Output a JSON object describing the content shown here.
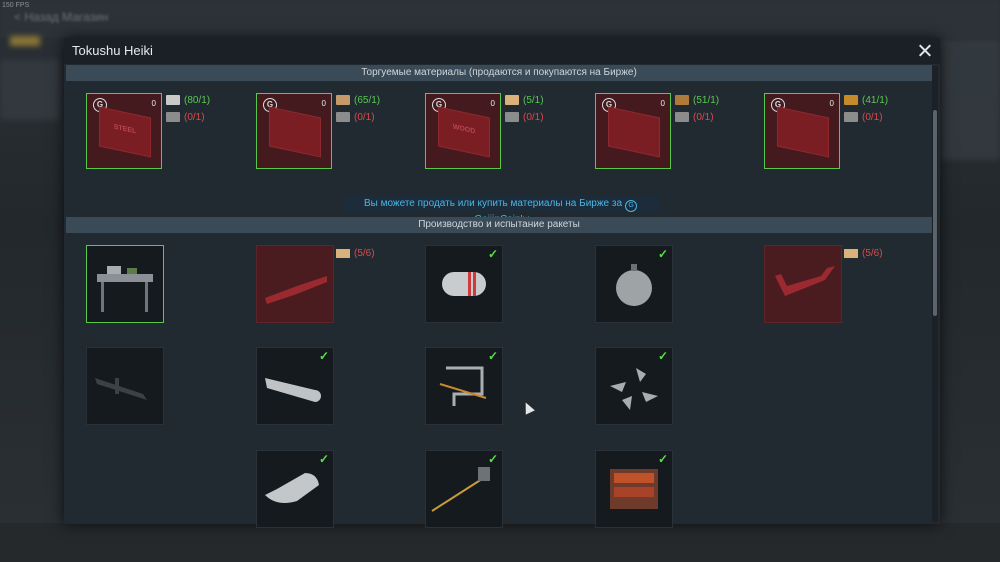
{
  "background": {
    "fps": "150 FPS",
    "title": "< Назад   Магазин"
  },
  "modal": {
    "title": "Tokushu Heiki",
    "close_icon": "close-icon"
  },
  "materials_section": {
    "header": "Торгуемые материалы (продаются и покупаются на Бирже)",
    "items": [
      {
        "name": "STEEL",
        "count": "0",
        "have": "(80/1)",
        "have_color": "green",
        "other": "(0/1)"
      },
      {
        "name": "",
        "count": "0",
        "have": "(65/1)",
        "have_color": "green",
        "other": "(0/1)"
      },
      {
        "name": "WOOD",
        "count": "0",
        "have": "(5/1)",
        "have_color": "green",
        "other": "(0/1)"
      },
      {
        "name": "",
        "count": "0",
        "have": "(51/1)",
        "have_color": "green",
        "other": "(0/1)"
      },
      {
        "name": "",
        "count": "0",
        "have": "(41/1)",
        "have_color": "green",
        "other": "(0/1)"
      }
    ],
    "info_prefix": "Вы можете продать или купить материалы на Бирже за",
    "info_coin": "G",
    "info_suffix": "GaijinCoin'ы"
  },
  "production_section": {
    "header": "Производство и испытание ракеты",
    "rows": [
      [
        {
          "kind": "workbench",
          "state": "selected",
          "check": false,
          "req": ""
        },
        {
          "kind": "wing-part",
          "state": "locked",
          "check": false,
          "req": "(5/6)"
        },
        {
          "kind": "warhead-cylinder",
          "state": "done",
          "check": true,
          "req": ""
        },
        {
          "kind": "sphere-tank",
          "state": "done",
          "check": true,
          "req": ""
        },
        {
          "kind": "tail-part",
          "state": "locked",
          "check": false,
          "req": "(5/6)"
        }
      ],
      [
        {
          "kind": "missile",
          "state": "normal",
          "check": false,
          "req": ""
        },
        {
          "kind": "engine-body",
          "state": "done",
          "check": true,
          "req": ""
        },
        {
          "kind": "pipes",
          "state": "done",
          "check": true,
          "req": ""
        },
        {
          "kind": "fins",
          "state": "done",
          "check": true,
          "req": ""
        }
      ],
      [
        {
          "kind": "fuel-tank",
          "state": "done",
          "check": true,
          "req": ""
        },
        {
          "kind": "antenna",
          "state": "done",
          "check": true,
          "req": ""
        },
        {
          "kind": "electronics",
          "state": "done",
          "check": true,
          "req": ""
        }
      ]
    ]
  },
  "colors": {
    "green": "#58c850",
    "red": "#e0474a",
    "accent": "#4ab6e6"
  }
}
